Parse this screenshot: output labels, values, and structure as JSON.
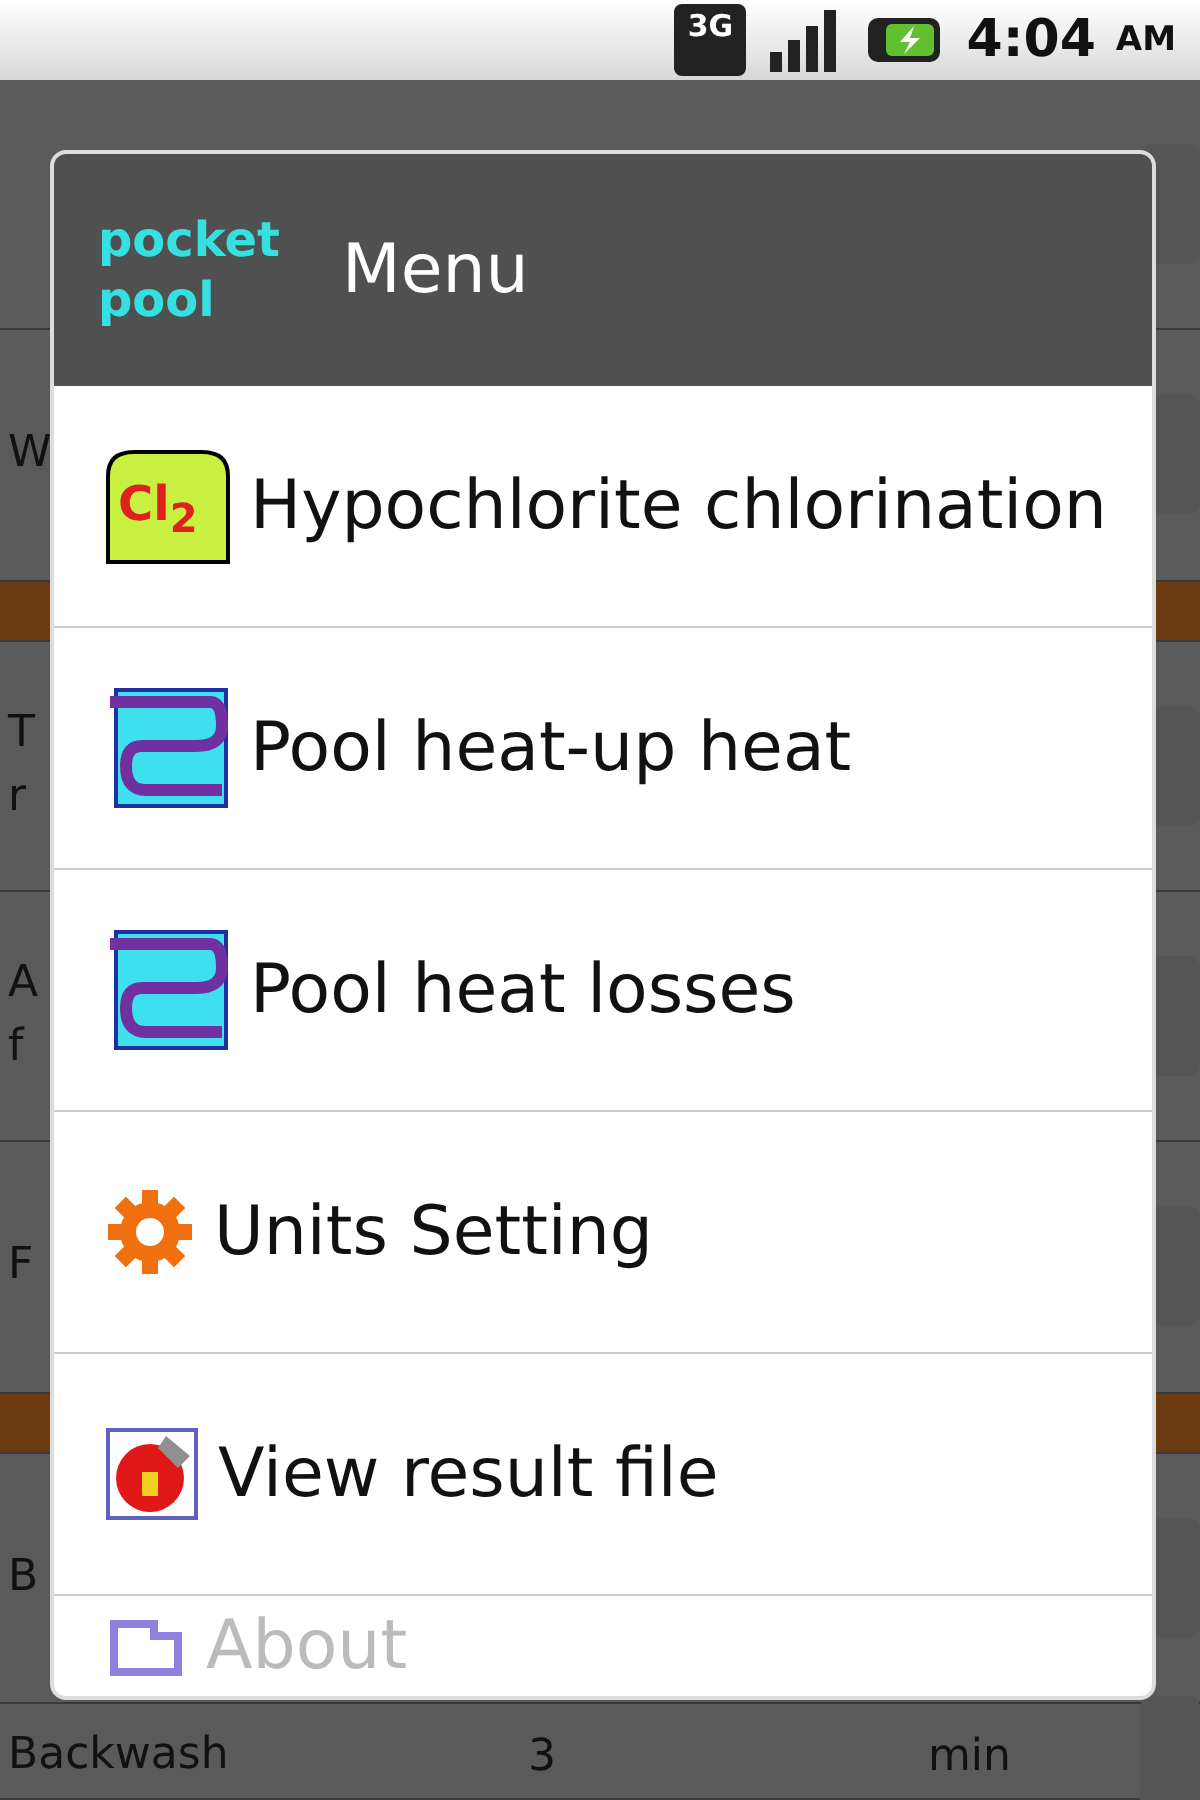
{
  "status_bar": {
    "network": "3G",
    "time": "4:04",
    "meridiem": "AM"
  },
  "background_form": {
    "rows": [
      {
        "kind": "input",
        "label": [],
        "value": "",
        "unit": ""
      },
      {
        "kind": "input",
        "label": [
          "W"
        ],
        "value": "",
        "unit": ""
      },
      {
        "kind": "section",
        "label": [],
        "value": "",
        "unit": ""
      },
      {
        "kind": "input",
        "label": [
          "T",
          "r"
        ],
        "value": "",
        "unit": ""
      },
      {
        "kind": "input",
        "label": [
          "A",
          "f"
        ],
        "value": "",
        "unit": ""
      },
      {
        "kind": "input",
        "label": [
          "F"
        ],
        "value": "",
        "unit": ""
      },
      {
        "kind": "section",
        "label": [],
        "value": "",
        "unit": ""
      },
      {
        "kind": "input",
        "label": [
          "B"
        ],
        "value": "",
        "unit": ""
      },
      {
        "kind": "last",
        "label": [
          "Backwash"
        ],
        "value": "3",
        "unit": "min"
      }
    ]
  },
  "menu": {
    "title": "Menu",
    "logo": [
      "pocket",
      "pool"
    ],
    "items": [
      {
        "label": "Hypochlorite chlorination",
        "kind": "chlorine",
        "icon_text": "Cl$_{2}$",
        "disabled": false
      },
      {
        "label": "Pool heat-up heat",
        "kind": "heater",
        "disabled": false
      },
      {
        "label": "Pool heat losses",
        "kind": "heater",
        "disabled": false
      },
      {
        "label": "Units Setting",
        "kind": "gear",
        "disabled": false
      },
      {
        "label": "View result file",
        "kind": "result",
        "disabled": false
      },
      {
        "label": "About",
        "kind": "about",
        "disabled": true
      }
    ]
  }
}
